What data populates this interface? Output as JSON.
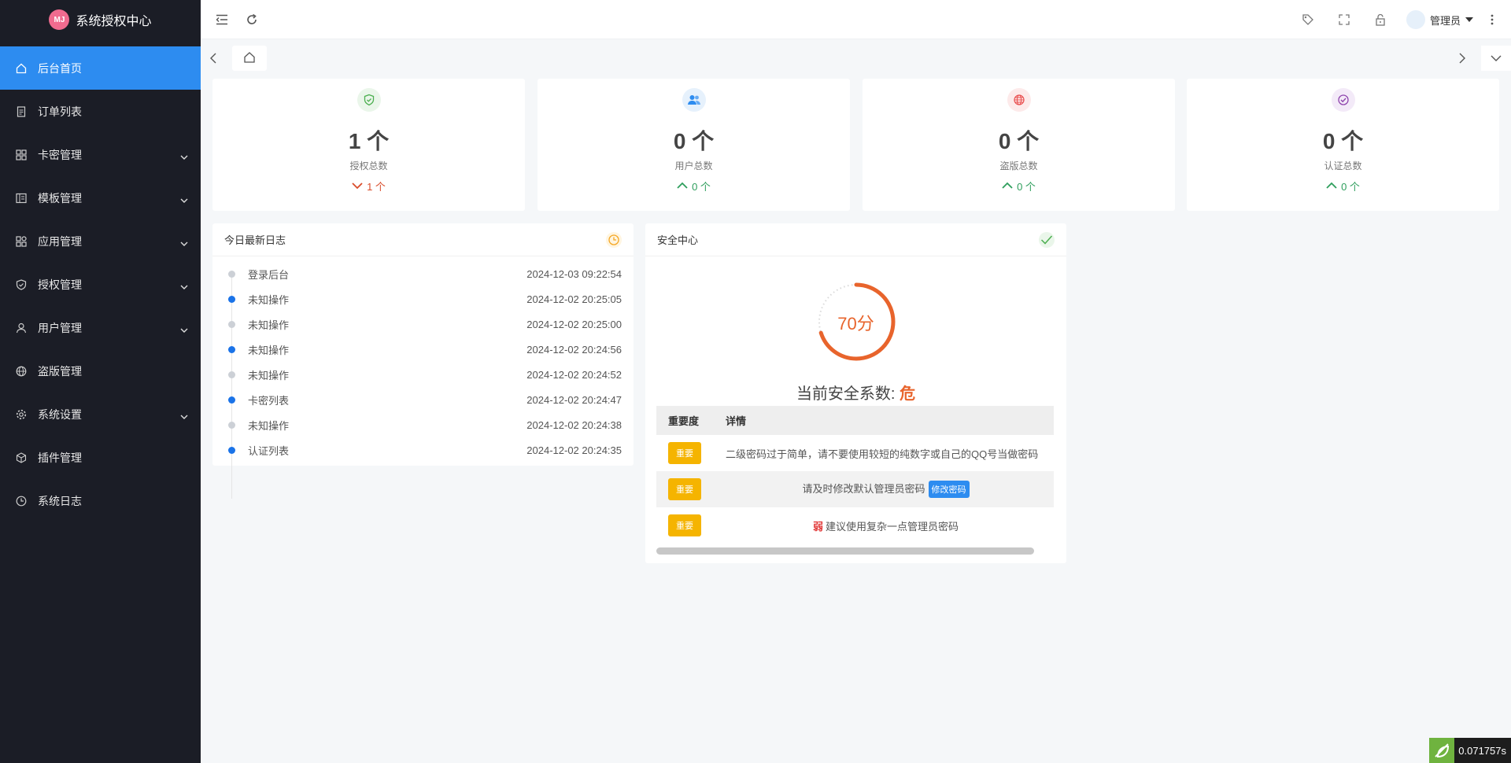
{
  "brand": {
    "title": "系统授权中心",
    "logo_text": "MJ"
  },
  "sidebar": {
    "items": [
      {
        "label": "后台首页",
        "icon": "home-icon",
        "expandable": false,
        "active": true
      },
      {
        "label": "订单列表",
        "icon": "document-icon",
        "expandable": false
      },
      {
        "label": "卡密管理",
        "icon": "grid-icon",
        "expandable": true
      },
      {
        "label": "模板管理",
        "icon": "template-icon",
        "expandable": true
      },
      {
        "label": "应用管理",
        "icon": "apps-icon",
        "expandable": true
      },
      {
        "label": "授权管理",
        "icon": "shield-check-icon",
        "expandable": true
      },
      {
        "label": "用户管理",
        "icon": "user-icon",
        "expandable": true
      },
      {
        "label": "盗版管理",
        "icon": "globe-icon",
        "expandable": false
      },
      {
        "label": "系统设置",
        "icon": "gear-icon",
        "expandable": true
      },
      {
        "label": "插件管理",
        "icon": "cube-icon",
        "expandable": false
      },
      {
        "label": "系统日志",
        "icon": "clock-icon",
        "expandable": false
      }
    ]
  },
  "header": {
    "user_name": "管理员"
  },
  "stats": [
    {
      "value": "1 个",
      "label": "授权总数",
      "trend": "1 个",
      "trend_dir": "down",
      "color": "#4caf50",
      "bg": "#eaf6ea",
      "icon": "shield-check-icon"
    },
    {
      "value": "0 个",
      "label": "用户总数",
      "trend": "0 个",
      "trend_dir": "up",
      "color": "#2d8cf0",
      "bg": "#e6f1fc",
      "icon": "users-icon"
    },
    {
      "value": "0 个",
      "label": "盗版总数",
      "trend": "0 个",
      "trend_dir": "up",
      "color": "#e94d4d",
      "bg": "#fdeaea",
      "icon": "globe-icon"
    },
    {
      "value": "0 个",
      "label": "认证总数",
      "trend": "0 个",
      "trend_dir": "up",
      "color": "#8e44ad",
      "bg": "#f3eaf8",
      "icon": "check-circle-icon"
    }
  ],
  "logs": {
    "title": "今日最新日志",
    "items": [
      {
        "text": "登录后台",
        "time": "2024-12-03 09:22:54",
        "dot": "gray"
      },
      {
        "text": "未知操作",
        "time": "2024-12-02 20:25:05",
        "dot": "blue"
      },
      {
        "text": "未知操作",
        "time": "2024-12-02 20:25:00",
        "dot": "gray"
      },
      {
        "text": "未知操作",
        "time": "2024-12-02 20:24:56",
        "dot": "blue"
      },
      {
        "text": "未知操作",
        "time": "2024-12-02 20:24:52",
        "dot": "gray"
      },
      {
        "text": "卡密列表",
        "time": "2024-12-02 20:24:47",
        "dot": "blue"
      },
      {
        "text": "未知操作",
        "time": "2024-12-02 20:24:38",
        "dot": "gray"
      },
      {
        "text": "认证列表",
        "time": "2024-12-02 20:24:35",
        "dot": "blue"
      }
    ]
  },
  "security": {
    "title": "安全中心",
    "score": "70分",
    "score_fraction": 0.7,
    "coef_label": "当前安全系数:",
    "coef_value": "危",
    "table_headers": [
      "重要度",
      "详情"
    ],
    "rows": [
      {
        "level": "重要",
        "detail": "二级密码过于简单，请不要使用较短的纯数字或自己的QQ号当做密码"
      },
      {
        "level": "重要",
        "detail": "请及时修改默认管理员密码",
        "action": "修改密码"
      },
      {
        "level": "重要",
        "detail": "建议使用复杂一点管理员密码",
        "prefix": "弱"
      }
    ]
  },
  "timer": {
    "value": "0.071757s"
  }
}
